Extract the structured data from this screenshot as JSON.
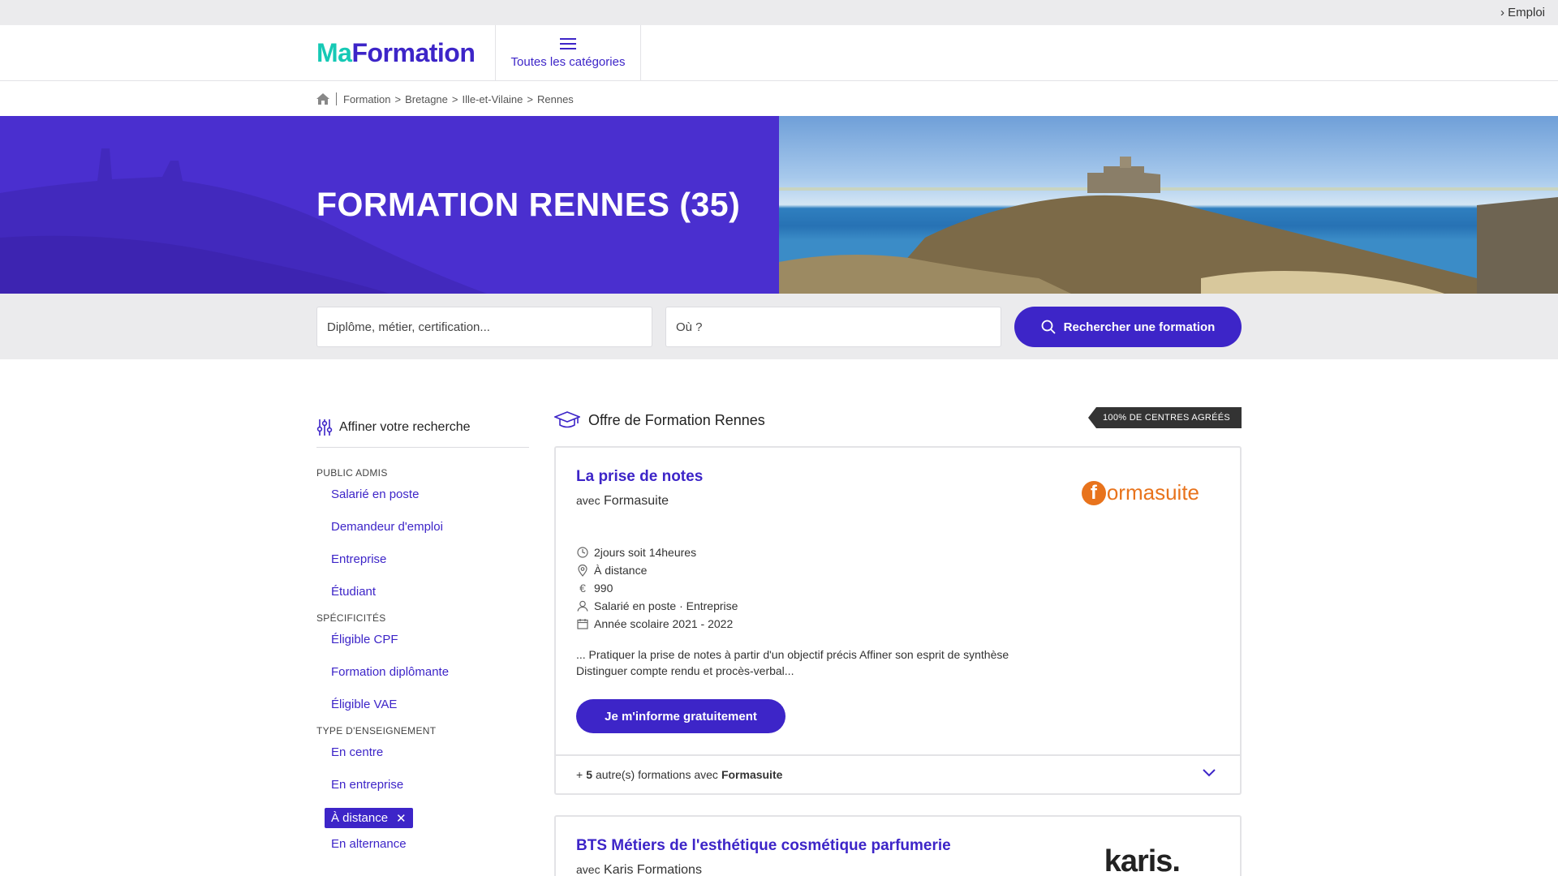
{
  "topbar": {
    "link": "› Emploi"
  },
  "header": {
    "logo_part1": "Ma",
    "logo_part2": "Formation",
    "categories_label": "Toutes les catégories"
  },
  "breadcrumb": [
    "Formation",
    "Bretagne",
    "Ille-et-Vilaine",
    "Rennes"
  ],
  "hero": {
    "title": "FORMATION RENNES (35)"
  },
  "search": {
    "what_placeholder": "Diplôme, métier, certification...",
    "where_placeholder": "Où ?",
    "button_label": "Rechercher une formation"
  },
  "sidebar": {
    "title": "Affiner votre recherche",
    "sections": [
      {
        "title": "PUBLIC ADMIS",
        "items": [
          "Salarié en poste",
          "Demandeur d'emploi",
          "Entreprise",
          "Étudiant"
        ]
      },
      {
        "title": "SPÉCIFICITÉS",
        "items": [
          "Éligible CPF",
          "Formation diplômante",
          "Éligible VAE"
        ]
      },
      {
        "title": "TYPE D'ENSEIGNEMENT",
        "items": [
          "En centre",
          "En entreprise"
        ],
        "active": "À distance",
        "items_after": [
          "En alternance"
        ]
      }
    ]
  },
  "main": {
    "title": "Offre de Formation Rennes",
    "badge": "100% DE CENTRES AGRÉÉS"
  },
  "cards": [
    {
      "title": "La prise de notes",
      "with_prefix": "avec",
      "provider": "Formasuite",
      "logo_text": "ormasuite",
      "logo_letter": "f",
      "details": {
        "duration": "2jours soit 14heures",
        "location": "À distance",
        "price": "990",
        "audience": "Salarié en poste · Entreprise",
        "period": "Année scolaire 2021 - 2022"
      },
      "excerpt": "... Pratiquer la prise de notes à partir d'un objectif précis Affiner son esprit de synthèse Distinguer compte rendu et procès-verbal...",
      "cta": "Je m'informe gratuitement",
      "more_prefix": "+",
      "more_count": "5",
      "more_middle": "autre(s) formations avec",
      "more_provider": "Formasuite"
    },
    {
      "title": "BTS Métiers de l'esthétique cosmétique parfumerie",
      "with_prefix": "avec",
      "provider": "Karis Formations",
      "logo_text": "karis."
    }
  ],
  "colors": {
    "brand": "#3d25c8",
    "accent": "#16c9b5",
    "orange": "#e8731c"
  }
}
